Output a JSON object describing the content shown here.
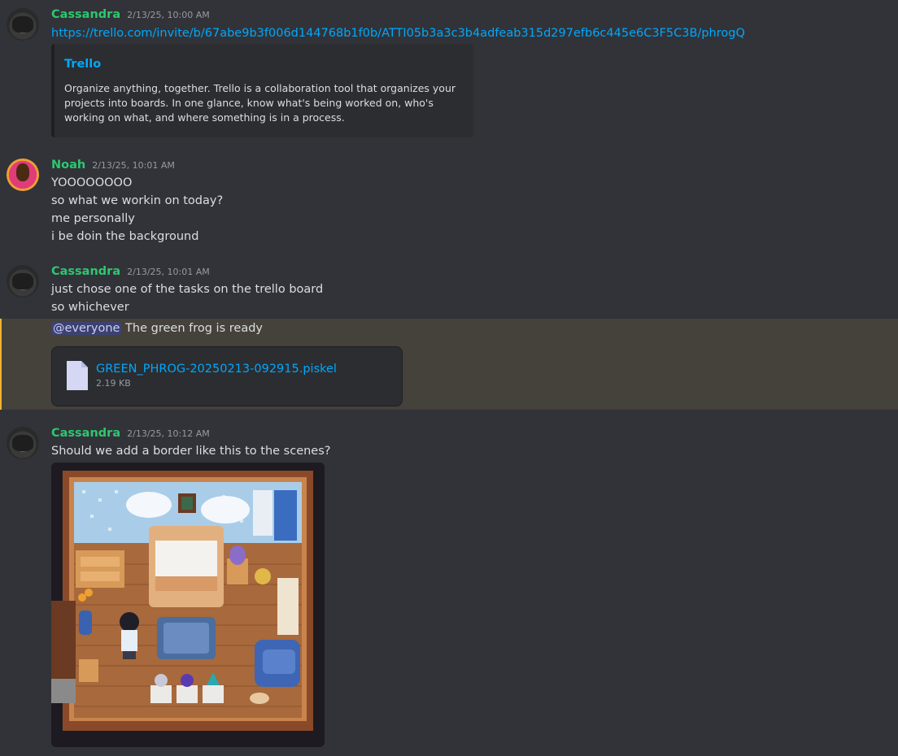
{
  "messages": [
    {
      "username": "Cassandra",
      "timestamp": "2/13/25, 10:00 AM",
      "link": "https://trello.com/invite/b/67abe9b3f006d144768b1f0b/ATTI05b3a3c3b4adfeab315d297efb6c445e6C3F5C3B/phrogQ",
      "embed": {
        "title": "Trello",
        "description": "Organize anything, together. Trello is a collaboration tool that organizes your projects into boards. In one glance, know what's being worked on, who's working on what, and where something is in a process."
      }
    },
    {
      "username": "Noah",
      "timestamp": "2/13/25, 10:01 AM",
      "lines": [
        "YOOOOOOOO",
        "so what we workin on today?",
        "me personally",
        "i be doin the background"
      ]
    },
    {
      "username": "Cassandra",
      "timestamp": "2/13/25, 10:01 AM",
      "lines": [
        "just chose one of the tasks on the trello board",
        "so whichever"
      ],
      "mention_message": {
        "mention": "@everyone",
        "text": " The green frog is ready"
      },
      "attachment": {
        "filename": "GREEN_PHROG-20250213-092915.piskel",
        "size": "2.19 KB"
      }
    },
    {
      "username": "Cassandra",
      "timestamp": "2/13/25, 10:12 AM",
      "lines": [
        "Should we add a border like this to the scenes?"
      ]
    }
  ],
  "colors": {
    "background": "#313338",
    "username_green": "#2dc770",
    "link_blue": "#00a8fc",
    "mention_highlight": "#45413b"
  },
  "icons": [
    "avatar-cassandra",
    "avatar-noah",
    "file-icon"
  ]
}
